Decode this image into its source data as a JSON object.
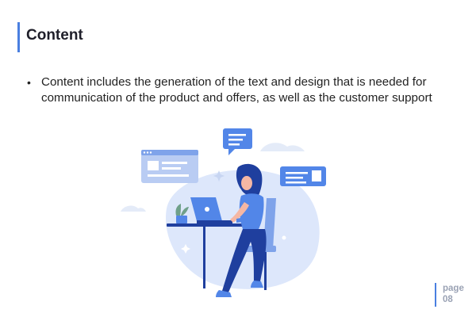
{
  "slide": {
    "title": "Content",
    "bullet": "Content includes the generation of the text and design that is needed for communication of the product and offers, as well as the customer support",
    "bullet_marker": "•"
  },
  "footer": {
    "page_word": "page",
    "page_number": "08"
  },
  "colors": {
    "accent": "#4a7fe0",
    "illustration_light": "#dde7fb",
    "illustration_blue": "#5286e8",
    "illustration_dark": "#1f3f9e"
  }
}
